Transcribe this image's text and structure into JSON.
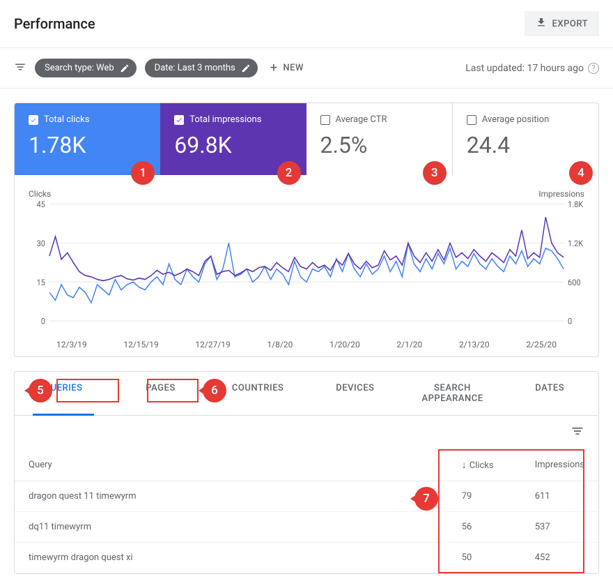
{
  "header": {
    "title": "Performance",
    "export_label": "EXPORT"
  },
  "filters": {
    "chips": [
      {
        "label": "Search type: Web"
      },
      {
        "label": "Date: Last 3 months"
      }
    ],
    "new_label": "NEW",
    "last_updated": "Last updated: 17 hours ago"
  },
  "metrics": [
    {
      "label": "Total clicks",
      "value": "1.78K",
      "state": "active-blue",
      "badge": "1"
    },
    {
      "label": "Total impressions",
      "value": "69.8K",
      "state": "active-purple",
      "badge": "2"
    },
    {
      "label": "Average CTR",
      "value": "2.5%",
      "state": "",
      "badge": "3"
    },
    {
      "label": "Average position",
      "value": "24.4",
      "state": "",
      "badge": "4"
    }
  ],
  "chart_data": {
    "type": "line",
    "title": "",
    "left_axis": {
      "label": "Clicks",
      "ticks": [
        0,
        15,
        30,
        45
      ]
    },
    "right_axis": {
      "label": "Impressions",
      "ticks": [
        0,
        600,
        1200,
        1800
      ],
      "tick_labels": [
        "0",
        "600",
        "1.2K",
        "1.8K"
      ]
    },
    "x": [
      "12/3/19",
      "12/15/19",
      "12/27/19",
      "1/8/20",
      "1/20/20",
      "2/1/20",
      "2/13/20",
      "2/25/20"
    ],
    "series": [
      {
        "name": "Clicks",
        "color": "#4285f4",
        "axis": "left",
        "values": [
          11,
          8,
          14,
          10,
          9,
          13,
          11,
          7,
          14,
          12,
          10,
          16,
          12,
          14,
          15,
          13,
          12,
          15,
          17,
          14,
          22,
          16,
          14,
          20,
          17,
          15,
          22,
          25,
          16,
          20,
          30,
          17,
          18,
          20,
          15,
          17,
          21,
          16,
          20,
          18,
          14,
          23,
          17,
          15,
          20,
          19,
          21,
          17,
          24,
          19,
          26,
          20,
          17,
          22,
          18,
          20,
          25,
          19,
          23,
          17,
          30,
          22,
          19,
          24,
          20,
          26,
          22,
          28,
          20,
          23,
          21,
          26,
          22,
          20,
          24,
          21,
          19,
          25,
          22,
          27,
          21,
          24,
          22,
          28,
          27,
          24,
          20
        ]
      },
      {
        "name": "Impressions",
        "color": "#5e35b1",
        "axis": "right",
        "values": [
          1000,
          1300,
          950,
          1050,
          900,
          760,
          700,
          680,
          640,
          620,
          640,
          680,
          700,
          650,
          630,
          660,
          640,
          700,
          780,
          720,
          750,
          700,
          740,
          800,
          760,
          700,
          920,
          1000,
          720,
          760,
          780,
          700,
          740,
          800,
          760,
          820,
          840,
          780,
          900,
          820,
          760,
          980,
          840,
          800,
          900,
          820,
          860,
          780,
          940,
          860,
          1040,
          880,
          800,
          920,
          820,
          860,
          1080,
          940,
          1000,
          860,
          1200,
          1000,
          900,
          1050,
          920,
          1100,
          940,
          1200,
          980,
          1050,
          960,
          1100,
          1000,
          920,
          1050,
          980,
          900,
          1100,
          1000,
          1400,
          960,
          1050,
          980,
          1600,
          1200,
          1050,
          980
        ]
      }
    ]
  },
  "tabs": [
    "QUERIES",
    "PAGES",
    "COUNTRIES",
    "DEVICES",
    "SEARCH APPEARANCE",
    "DATES"
  ],
  "tabs_active": 0,
  "tab_badges": {
    "queries": "5",
    "pages": "6"
  },
  "table": {
    "columns": {
      "query": "Query",
      "clicks": "Clicks",
      "impressions": "Impressions"
    },
    "rows": [
      {
        "query": "dragon quest 11 timewyrm",
        "clicks": "79",
        "impressions": "611"
      },
      {
        "query": "dq11 timewyrm",
        "clicks": "56",
        "impressions": "537"
      },
      {
        "query": "timewyrm dragon quest xi",
        "clicks": "50",
        "impressions": "452"
      }
    ],
    "badge": "7"
  }
}
